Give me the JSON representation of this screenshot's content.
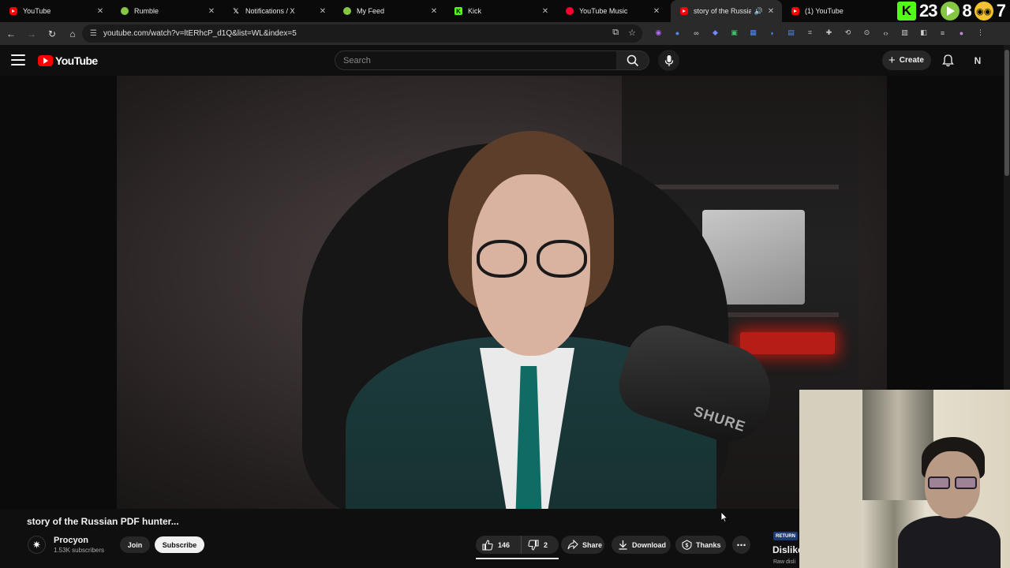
{
  "browser": {
    "tabs": [
      {
        "title": "YouTube",
        "favicon": "youtube-icon",
        "active": false
      },
      {
        "title": "Rumble",
        "favicon": "rumble-icon",
        "active": false
      },
      {
        "title": "Notifications / X",
        "favicon": "x-icon",
        "active": false
      },
      {
        "title": "My Feed",
        "favicon": "rumble-icon",
        "active": false
      },
      {
        "title": "Kick",
        "favicon": "kick-icon",
        "active": false
      },
      {
        "title": "YouTube Music",
        "favicon": "youtube-music-icon",
        "active": false
      },
      {
        "title": "story of the Russian PDF hunter...",
        "favicon": "youtube-icon",
        "active": true
      },
      {
        "title": "(1) YouTube",
        "favicon": "youtube-icon",
        "active": false
      }
    ],
    "extension_badges": {
      "kick": "23",
      "rumble": "8",
      "other": "7"
    },
    "url": "youtube.com/watch?v=ltERhcP_d1Q&list=WL&index=5"
  },
  "youtube": {
    "logo_text": "YouTube",
    "search_placeholder": "Search",
    "create_label": "Create",
    "avatar_letter": "N"
  },
  "video": {
    "title": "story of the Russian PDF hunter...",
    "mic_brand": "SHURE"
  },
  "channel": {
    "name": "Procyon",
    "subscribers": "1.53K subscribers",
    "join_label": "Join",
    "subscribe_label": "Subscribe"
  },
  "actions": {
    "likes": "146",
    "dislikes": "2",
    "share_label": "Share",
    "download_label": "Download",
    "thanks_label": "Thanks",
    "more_label": "⋯"
  },
  "return_dislike_panel": {
    "badge": "RETURN",
    "title": "Dislike",
    "subtitle": "Raw disli"
  },
  "colors": {
    "youtube_red": "#ff0000",
    "page_bg": "#0f0f0f",
    "button_bg": "#272727"
  }
}
